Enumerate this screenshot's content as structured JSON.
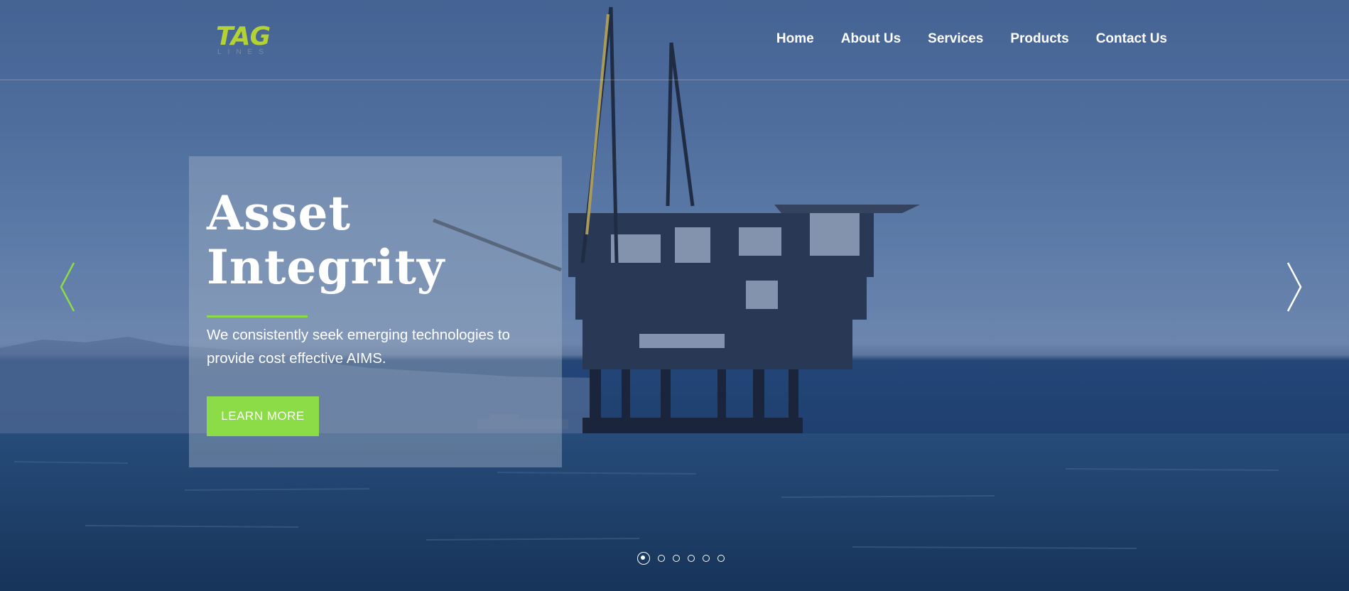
{
  "brand": {
    "logo_text": "TAG",
    "logo_sub": "LINES",
    "accent_color": "#8bdc46"
  },
  "nav": {
    "items": [
      {
        "label": "Home"
      },
      {
        "label": "About Us"
      },
      {
        "label": "Services"
      },
      {
        "label": "Products"
      },
      {
        "label": "Contact Us"
      }
    ]
  },
  "slider": {
    "title_line1": "Asset",
    "title_line2": "Integrity",
    "description": "We consistently seek emerging technologies to provide cost effective AIMS.",
    "button_label": "LEARN MORE",
    "background_image": "offshore-oil-platform",
    "prev_icon": "chevron-left-icon",
    "next_icon": "chevron-right-icon",
    "dot_count": 6,
    "active_dot": 1
  }
}
